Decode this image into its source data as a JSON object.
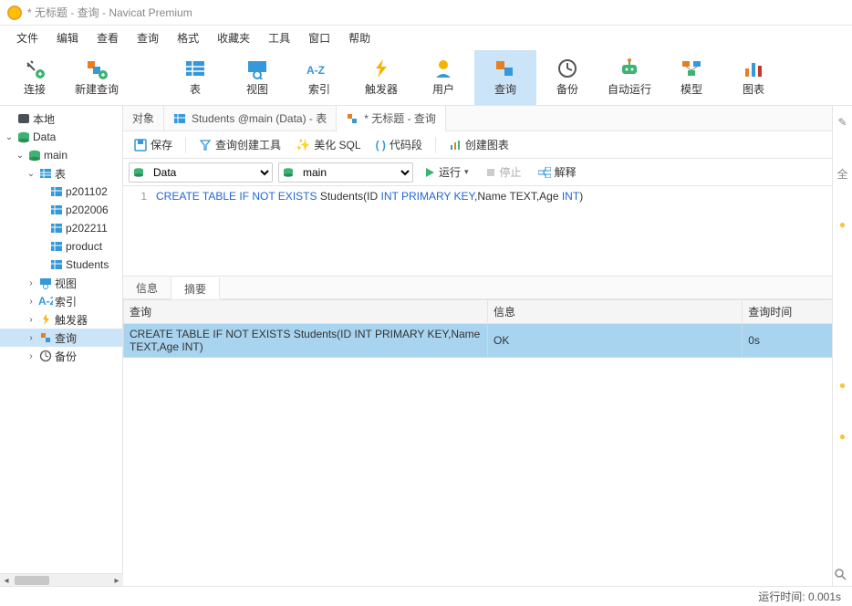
{
  "window": {
    "title": "* 无标题 - 查询 - Navicat Premium"
  },
  "menu": [
    "文件",
    "编辑",
    "查看",
    "查询",
    "格式",
    "收藏夹",
    "工具",
    "窗口",
    "帮助"
  ],
  "toolbar": [
    {
      "id": "connect",
      "label": "连接",
      "icon": "plug"
    },
    {
      "id": "new-query",
      "label": "新建查询",
      "icon": "new-query"
    },
    {
      "id": "table",
      "label": "表",
      "icon": "table"
    },
    {
      "id": "view",
      "label": "视图",
      "icon": "view"
    },
    {
      "id": "index",
      "label": "索引",
      "icon": "az"
    },
    {
      "id": "trigger",
      "label": "触发器",
      "icon": "bolt"
    },
    {
      "id": "user",
      "label": "用户",
      "icon": "user"
    },
    {
      "id": "query",
      "label": "查询",
      "icon": "query",
      "active": true
    },
    {
      "id": "backup",
      "label": "备份",
      "icon": "clock"
    },
    {
      "id": "auto-run",
      "label": "自动运行",
      "icon": "robot"
    },
    {
      "id": "model",
      "label": "模型",
      "icon": "model"
    },
    {
      "id": "chart",
      "label": "图表",
      "icon": "bars"
    }
  ],
  "tree": {
    "root": {
      "label": "本地",
      "icon": "db-dark"
    },
    "database": {
      "label": "Data",
      "icon": "db-green"
    },
    "main": {
      "label": "main",
      "icon": "db-green"
    },
    "tables_group": {
      "label": "表",
      "icon": "table-blue"
    },
    "tables": [
      "p201102",
      "p202006",
      "p202211",
      "product",
      "Students"
    ],
    "nodes": [
      {
        "label": "视图",
        "icon": "view-small"
      },
      {
        "label": "索引",
        "icon": "az-small"
      },
      {
        "label": "触发器",
        "icon": "bolt-small"
      },
      {
        "label": "查询",
        "icon": "query-small",
        "selected": true
      },
      {
        "label": "备份",
        "icon": "clock-small"
      }
    ]
  },
  "tabs": [
    {
      "id": "objects",
      "label": "对象",
      "active": false
    },
    {
      "id": "students-data",
      "label": "Students @main (Data) - 表",
      "icon": "table-blue",
      "active": false
    },
    {
      "id": "query-untitled",
      "label": "* 无标题 - 查询",
      "icon": "query-small",
      "active": true
    }
  ],
  "actions": {
    "save": "保存",
    "query_builder": "查询创建工具",
    "beautify": "美化 SQL",
    "snippets": "代码段",
    "create_chart": "创建图表"
  },
  "dropdowns": {
    "connection": "Data",
    "database": "main",
    "run": "运行",
    "stop": "停止",
    "explain": "解释"
  },
  "editor": {
    "line_number": "1",
    "tokens": [
      {
        "t": "CREATE TABLE IF NOT EXISTS",
        "c": "kw"
      },
      {
        "t": " Students(ID ",
        "c": "plain"
      },
      {
        "t": "INT PRIMARY KEY",
        "c": "kw"
      },
      {
        "t": ",Name TEXT,Age ",
        "c": "plain"
      },
      {
        "t": "INT",
        "c": "kw"
      },
      {
        "t": ")",
        "c": "plain"
      }
    ]
  },
  "result_tabs": {
    "info": "信息",
    "summary": "摘要"
  },
  "result_table": {
    "headers": {
      "query": "查询",
      "message": "信息",
      "time": "查询时间"
    },
    "rows": [
      {
        "query": "CREATE TABLE IF NOT EXISTS Students(ID INT PRIMARY KEY,Name TEXT,Age INT)",
        "message": "OK",
        "time": "0s"
      }
    ]
  },
  "status": {
    "runtime_label": "运行时间:",
    "runtime_value": "0.001s"
  },
  "right_panel": {
    "label": "全"
  }
}
